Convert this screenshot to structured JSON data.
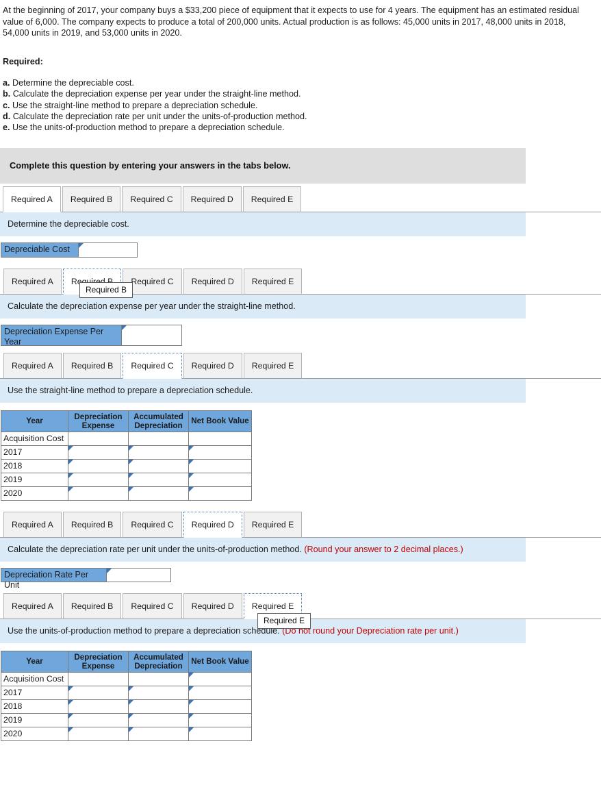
{
  "problem": {
    "statement": "At the beginning of 2017, your company buys a $33,200 piece of equipment that it expects to use for 4 years. The equipment has an estimated residual value of 6,000. The company expects to produce a total of 200,000 units. Actual production is as follows: 45,000 units in 2017, 48,000 units in 2018, 54,000 units in 2019, and 53,000 units in 2020."
  },
  "required": {
    "heading": "Required:",
    "items": [
      {
        "letter": "a.",
        "text": "Determine the depreciable cost."
      },
      {
        "letter": "b.",
        "text": "Calculate the depreciation expense per year under the straight-line method."
      },
      {
        "letter": "c.",
        "text": "Use the straight-line method to prepare a depreciation schedule."
      },
      {
        "letter": "d.",
        "text": "Calculate the depreciation rate per unit under the units-of-production method."
      },
      {
        "letter": "e.",
        "text": "Use the units-of-production method to prepare a depreciation schedule."
      }
    ]
  },
  "banner": {
    "text": "Complete this question by entering your answers in the tabs below."
  },
  "tabs": {
    "labels": [
      "Required A",
      "Required B",
      "Required C",
      "Required D",
      "Required E"
    ]
  },
  "sections": [
    {
      "active_tab_index": 0,
      "tooltip": null,
      "prompt": "Determine the depreciable cost.",
      "hint": "",
      "field": {
        "label": "Depreciable Cost",
        "value": "",
        "placeholder": ""
      }
    },
    {
      "active_tab_index": 1,
      "tooltip": "Required B",
      "prompt": "Calculate the depreciation expense per year under the straight-line method.",
      "hint": "",
      "field": {
        "label": "Depreciation Expense Per Year",
        "value": "",
        "placeholder": ""
      }
    },
    {
      "active_tab_index": 2,
      "tooltip": null,
      "prompt": "Use the straight-line method to prepare a depreciation schedule.",
      "hint": "",
      "table": "schedule"
    },
    {
      "active_tab_index": 3,
      "tooltip": null,
      "prompt": "Calculate the depreciation rate per unit under the units-of-production method. ",
      "hint": "(Round your answer to 2 decimal places.)",
      "field": {
        "label": "Depreciation Rate Per Unit",
        "value": "",
        "placeholder": ""
      }
    },
    {
      "active_tab_index": 4,
      "tooltip": "Required E",
      "prompt": "Use the units-of-production method to prepare a depreciation schedule. ",
      "hint": "(Do not round your Depreciation rate per unit.)",
      "table": "schedule"
    }
  ],
  "schedule": {
    "headers": [
      "Year",
      "Depreciation Expense",
      "Accumulated Depreciation",
      "Net Book Value"
    ],
    "rows": [
      {
        "year": "Acquisition Cost",
        "depreciation_expense": "",
        "accumulated_depreciation": "",
        "net_book_value": "",
        "editable": [
          false,
          false,
          true
        ]
      },
      {
        "year": "2017",
        "depreciation_expense": "",
        "accumulated_depreciation": "",
        "net_book_value": "",
        "editable": [
          true,
          true,
          true
        ]
      },
      {
        "year": "2018",
        "depreciation_expense": "",
        "accumulated_depreciation": "",
        "net_book_value": "",
        "editable": [
          true,
          true,
          true
        ]
      },
      {
        "year": "2019",
        "depreciation_expense": "",
        "accumulated_depreciation": "",
        "net_book_value": "",
        "editable": [
          true,
          true,
          true
        ]
      },
      {
        "year": "2020",
        "depreciation_expense": "",
        "accumulated_depreciation": "",
        "net_book_value": "",
        "editable": [
          true,
          true,
          true
        ]
      }
    ]
  },
  "colors": {
    "header_blue": "#6fa7dd",
    "panel_blue": "#dbeaf7",
    "banner_gray": "#dedede",
    "hint_red": "#c00000",
    "flag_blue": "#3f72b5"
  }
}
